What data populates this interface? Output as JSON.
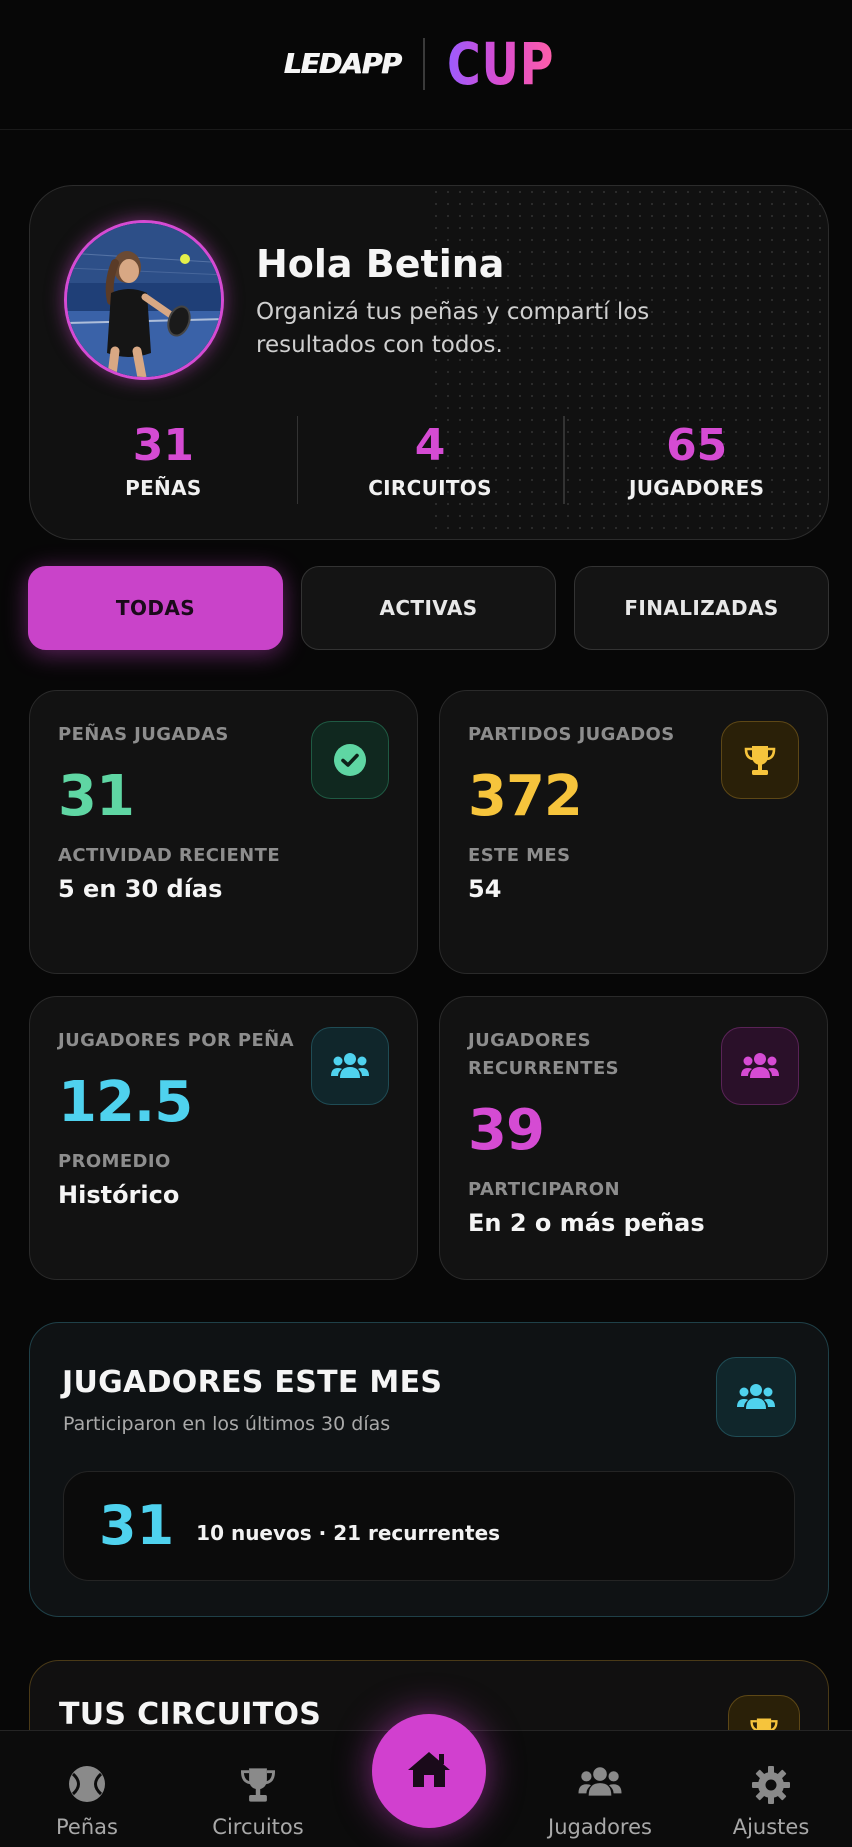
{
  "header": {
    "brand_left": "LEDAPP",
    "brand_right": "CUP"
  },
  "profile": {
    "greeting": "Hola Betina",
    "subtitle": "Organizá tus peñas y compartí los resultados con todos.",
    "stats": [
      {
        "value": "31",
        "label": "PEÑAS"
      },
      {
        "value": "4",
        "label": "CIRCUITOS"
      },
      {
        "value": "65",
        "label": "JUGADORES"
      }
    ]
  },
  "filters": [
    {
      "label": "TODAS",
      "active": true
    },
    {
      "label": "ACTIVAS",
      "active": false
    },
    {
      "label": "FINALIZADAS",
      "active": false
    }
  ],
  "metrics": [
    {
      "label": "PEÑAS JUGADAS",
      "value": "31",
      "sublabel": "ACTIVIDAD RECIENTE",
      "subvalue": "5 en 30 días",
      "color": "#5fd6a3",
      "icon": "check-circle-icon"
    },
    {
      "label": "PARTIDOS JUGADOS",
      "value": "372",
      "sublabel": "ESTE MES",
      "subvalue": "54",
      "color": "#f6c43c",
      "icon": "trophy-icon"
    },
    {
      "label": "JUGADORES POR PEÑA",
      "value": "12.5",
      "sublabel": "PROMEDIO",
      "subvalue": "Histórico",
      "color": "#4fd2ee",
      "icon": "users-icon"
    },
    {
      "label": "JUGADORES RECURRENTES",
      "value": "39",
      "sublabel": "PARTICIPARON",
      "subvalue": "En 2 o más peñas",
      "color": "#d54bd3",
      "icon": "users-icon"
    }
  ],
  "month": {
    "title": "JUGADORES ESTE MES",
    "subtitle": "Participaron en los últimos 30 días",
    "count": "31",
    "detail": "10 nuevos · 21 recurrentes"
  },
  "circuits": {
    "title": "TUS CIRCUITOS"
  },
  "nav": {
    "items": [
      {
        "label": "Peñas",
        "icon": "tennis-ball-icon"
      },
      {
        "label": "Circuitos",
        "icon": "trophy-icon"
      },
      {
        "label": "Jugadores",
        "icon": "users-icon"
      },
      {
        "label": "Ajustes",
        "icon": "gear-icon"
      }
    ],
    "home_icon": "home-icon"
  },
  "colors": {
    "accent": "#d54bd3",
    "background": "#070707"
  }
}
